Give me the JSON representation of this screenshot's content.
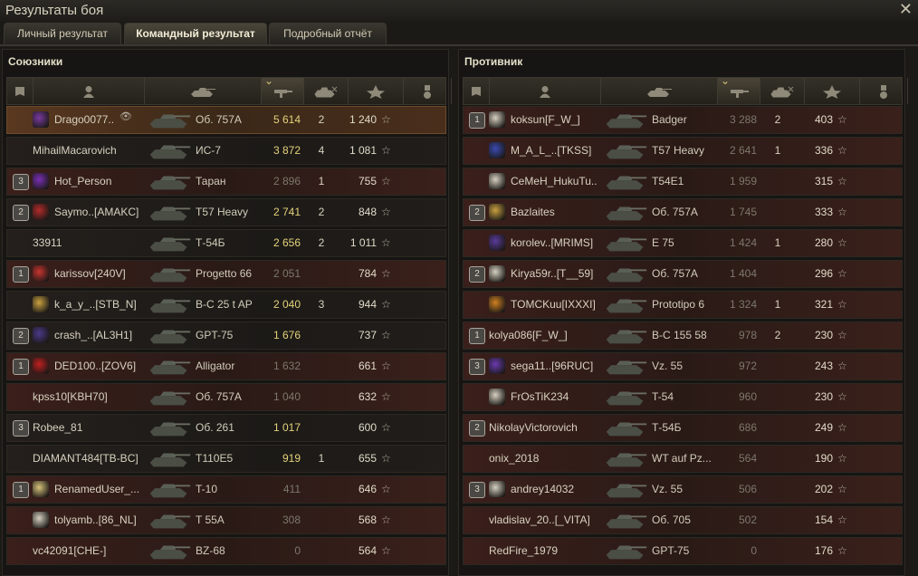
{
  "window": {
    "title": "Результаты боя",
    "close_label": "✕"
  },
  "tabs": [
    {
      "label": "Личный результат",
      "active": false
    },
    {
      "label": "Командный результат",
      "active": true
    },
    {
      "label": "Подробный отчёт",
      "active": false
    }
  ],
  "header_icons": [
    "platoon-icon",
    "player-icon",
    "tank-icon",
    "damage-icon",
    "kills-icon",
    "xp-star-icon",
    "medal-icon"
  ],
  "allies": {
    "title": "Союзники",
    "rows": [
      {
        "platoon": "",
        "name": "Drago0077..",
        "tank": "Об. 757А",
        "damage": "5 614",
        "dmg_style": "gold",
        "kills": "2",
        "xp": "1 240",
        "style": "self",
        "emblem_color": "#7a3aa0",
        "spotted_icon": true
      },
      {
        "platoon": "",
        "name": "MihailMacarovich",
        "tank": "ИС-7",
        "damage": "3 872",
        "dmg_style": "gold",
        "kills": "4",
        "xp": "1 081",
        "style": "dark",
        "emblem_color": ""
      },
      {
        "platoon": "3",
        "name": "Hot_Person",
        "tank": "Таран",
        "damage": "2 896",
        "dmg_style": "grey",
        "kills": "1",
        "xp": "755",
        "style": "red",
        "emblem_color": "#7b2fb5"
      },
      {
        "platoon": "2",
        "name": "Saymo..[AMAKC]",
        "tank": "T57 Heavy",
        "damage": "2 741",
        "dmg_style": "gold",
        "kills": "2",
        "xp": "848",
        "style": "dark",
        "emblem_color": "#b22a2a"
      },
      {
        "platoon": "",
        "name": "33911",
        "tank": "Т-54Б",
        "damage": "2 656",
        "dmg_style": "gold",
        "kills": "2",
        "xp": "1 011",
        "style": "dark",
        "emblem_color": ""
      },
      {
        "platoon": "1",
        "name": "karissov[240V]",
        "tank": "Progetto 66",
        "damage": "2 051",
        "dmg_style": "grey",
        "kills": "",
        "xp": "784",
        "style": "red",
        "emblem_color": "#c8342f"
      },
      {
        "platoon": "",
        "name": "k_a_y_..[STB_N]",
        "tank": "B-C 25 t AP",
        "damage": "2 040",
        "dmg_style": "gold",
        "kills": "3",
        "xp": "944",
        "style": "dark",
        "emblem_color": "#c9a040"
      },
      {
        "platoon": "2",
        "name": "crash_..[AL3H1]",
        "tank": "GPT-75",
        "damage": "1 676",
        "dmg_style": "gold",
        "kills": "",
        "xp": "737",
        "style": "dark",
        "emblem_color": "#4a3a8a"
      },
      {
        "platoon": "1",
        "name": "DED100..[ZOV6]",
        "tank": "Alligator",
        "damage": "1 632",
        "dmg_style": "grey",
        "kills": "",
        "xp": "661",
        "style": "red",
        "emblem_color": "#c02020"
      },
      {
        "platoon": "",
        "name": "kpss10[KBH70]",
        "tank": "Об. 757А",
        "damage": "1 040",
        "dmg_style": "grey",
        "kills": "",
        "xp": "632",
        "style": "red",
        "emblem_color": ""
      },
      {
        "platoon": "3",
        "name": "Robee_81",
        "tank": "Об. 261",
        "damage": "1 017",
        "dmg_style": "gold",
        "kills": "",
        "xp": "600",
        "style": "dark",
        "emblem_color": ""
      },
      {
        "platoon": "",
        "name": "DIAMANT484[TB-BC]",
        "tank": "T110E5",
        "damage": "919",
        "dmg_style": "gold",
        "kills": "1",
        "xp": "655",
        "style": "dark",
        "emblem_color": ""
      },
      {
        "platoon": "1",
        "name": "RenamedUser_...",
        "tank": "T-10",
        "damage": "411",
        "dmg_style": "grey",
        "kills": "",
        "xp": "646",
        "style": "red",
        "emblem_color": "#d8c27a"
      },
      {
        "platoon": "",
        "name": "tolyamb..[86_NL]",
        "tank": "T 55A",
        "damage": "308",
        "dmg_style": "grey",
        "kills": "",
        "xp": "568",
        "style": "red",
        "emblem_color": "#d6d0c0"
      },
      {
        "platoon": "",
        "name": "vc42091[CHE-]",
        "tank": "BZ-68",
        "damage": "0",
        "dmg_style": "grey",
        "kills": "",
        "xp": "564",
        "style": "red",
        "emblem_color": ""
      }
    ]
  },
  "enemies": {
    "title": "Противник",
    "rows": [
      {
        "platoon": "1",
        "name": "koksun[F_W_]",
        "tank": "Badger",
        "damage": "3 288",
        "dmg_style": "grey",
        "kills": "2",
        "xp": "403",
        "style": "red",
        "emblem_color": "#d6d0c0"
      },
      {
        "platoon": "",
        "name": "M_A_L_..[TKSS]",
        "tank": "T57 Heavy",
        "damage": "2 641",
        "dmg_style": "grey",
        "kills": "1",
        "xp": "336",
        "style": "red",
        "emblem_color": "#3a4ab0"
      },
      {
        "platoon": "",
        "name": "CeMeH_HukuTu..",
        "tank": "T54E1",
        "damage": "1 959",
        "dmg_style": "grey",
        "kills": "",
        "xp": "315",
        "style": "red",
        "emblem_color": "#d6d0c0"
      },
      {
        "platoon": "2",
        "name": "Bazlaites",
        "tank": "Об. 757А",
        "damage": "1 745",
        "dmg_style": "grey",
        "kills": "",
        "xp": "333",
        "style": "red",
        "emblem_color": "#c9a040"
      },
      {
        "platoon": "",
        "name": "korolev..[MRIMS]",
        "tank": "E 75",
        "damage": "1 424",
        "dmg_style": "grey",
        "kills": "1",
        "xp": "280",
        "style": "red",
        "emblem_color": "#5a3a9a"
      },
      {
        "platoon": "2",
        "name": "Kirya59r..[T__59]",
        "tank": "Об. 757А",
        "damage": "1 404",
        "dmg_style": "grey",
        "kills": "",
        "xp": "296",
        "style": "red",
        "emblem_color": "#d6d0c0"
      },
      {
        "platoon": "",
        "name": "TOMCKuu[IXXXI]",
        "tank": "Prototipo 6",
        "damage": "1 324",
        "dmg_style": "grey",
        "kills": "1",
        "xp": "321",
        "style": "red",
        "emblem_color": "#d08020"
      },
      {
        "platoon": "1",
        "name": "kolya086[F_W_]",
        "tank": "B-C 155 58",
        "damage": "978",
        "dmg_style": "grey",
        "kills": "2",
        "xp": "230",
        "style": "red",
        "emblem_color": ""
      },
      {
        "platoon": "3",
        "name": "sega11..[96RUC]",
        "tank": "Vz. 55",
        "damage": "972",
        "dmg_style": "grey",
        "kills": "",
        "xp": "243",
        "style": "red",
        "emblem_color": "#6a3ab0"
      },
      {
        "platoon": "",
        "name": "FrOsTiK234",
        "tank": "T-54",
        "damage": "960",
        "dmg_style": "grey",
        "kills": "",
        "xp": "230",
        "style": "red",
        "emblem_color": "#d6d0c0"
      },
      {
        "platoon": "2",
        "name": "NikolayVictorovich",
        "tank": "Т-54Б",
        "damage": "686",
        "dmg_style": "grey",
        "kills": "",
        "xp": "249",
        "style": "red",
        "emblem_color": ""
      },
      {
        "platoon": "",
        "name": "onix_2018",
        "tank": "WT auf Pz...",
        "damage": "564",
        "dmg_style": "grey",
        "kills": "",
        "xp": "190",
        "style": "red",
        "emblem_color": ""
      },
      {
        "platoon": "3",
        "name": "andrey14032",
        "tank": "Vz. 55",
        "damage": "506",
        "dmg_style": "grey",
        "kills": "",
        "xp": "202",
        "style": "red",
        "emblem_color": "#d6d0c0"
      },
      {
        "platoon": "",
        "name": "vladislav_20..[_VITA]",
        "tank": "Об. 705",
        "damage": "502",
        "dmg_style": "grey",
        "kills": "",
        "xp": "154",
        "style": "red",
        "emblem_color": ""
      },
      {
        "platoon": "",
        "name": "RedFire_1979",
        "tank": "GPT-75",
        "damage": "0",
        "dmg_style": "grey",
        "kills": "",
        "xp": "176",
        "style": "red",
        "emblem_color": ""
      }
    ]
  },
  "star_glyph": "☆"
}
